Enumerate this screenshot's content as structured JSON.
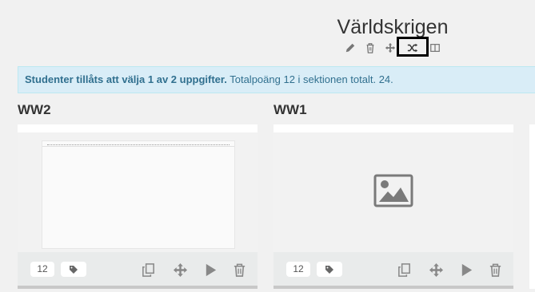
{
  "section": {
    "title": "Världskrigen",
    "toolbar": [
      {
        "name": "edit",
        "icon": "pencil-icon"
      },
      {
        "name": "delete",
        "icon": "trash-icon"
      },
      {
        "name": "move",
        "icon": "move-icon"
      },
      {
        "name": "shuffle",
        "icon": "shuffle-icon",
        "highlighted": true
      },
      {
        "name": "columns",
        "icon": "columns-icon"
      }
    ]
  },
  "info": {
    "bold": "Studenter tillåts att välja 1 av 2 uppgifter.",
    "rest": " Totalpoäng 12 i sektionen totalt. 24."
  },
  "cards": [
    {
      "title": "WW2",
      "points": "12",
      "thumbnail": "document-preview"
    },
    {
      "title": "WW1",
      "points": "12",
      "thumbnail": "image-placeholder"
    }
  ],
  "colors": {
    "info_bg": "#d9edf7",
    "info_text": "#31708f",
    "highlight_border": "#000000"
  }
}
